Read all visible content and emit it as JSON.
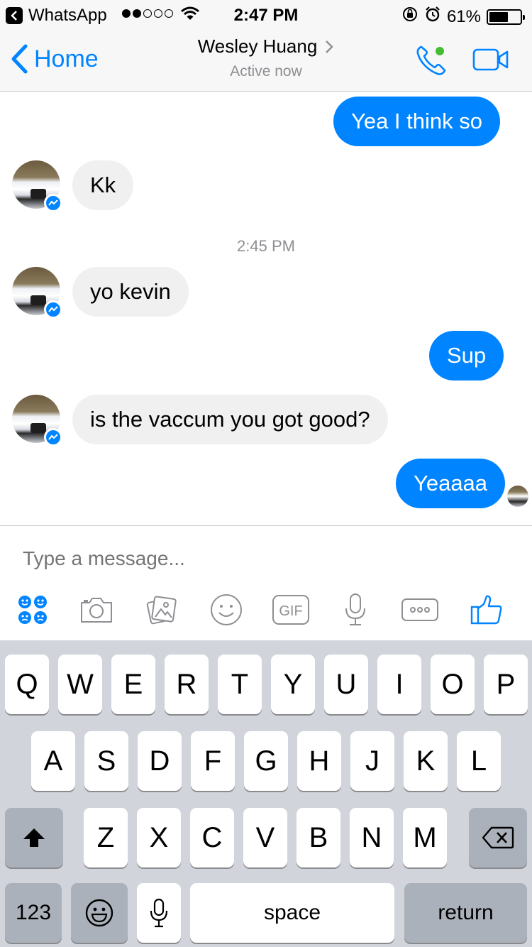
{
  "status_bar": {
    "back_app": "WhatsApp",
    "time": "2:47 PM",
    "battery": "61%",
    "battery_level": 0.61,
    "signal_bars_filled": 2,
    "signal_bars_total": 5
  },
  "nav": {
    "back_label": "Home",
    "contact_name": "Wesley Huang",
    "contact_status": "Active now",
    "accent_color": "#0084ff",
    "online_color": "#44bd32"
  },
  "messages": [
    {
      "direction": "outgoing",
      "text": "Yea I think so"
    },
    {
      "direction": "incoming",
      "text": "Kk"
    },
    {
      "direction": "incoming",
      "text": "yo kevin"
    },
    {
      "direction": "outgoing",
      "text": "Sup"
    },
    {
      "direction": "incoming",
      "text": "is the vaccum you got good?"
    },
    {
      "direction": "outgoing",
      "text": "Yeaaaa"
    }
  ],
  "timestamp": "2:45 PM",
  "composer": {
    "placeholder": "Type a message...",
    "tools": [
      "stickers-icon",
      "camera-icon",
      "gallery-icon",
      "emoji-icon",
      "gif-icon",
      "microphone-icon",
      "more-icon",
      "thumbs-up-icon"
    ],
    "gif_label": "GIF"
  },
  "keyboard": {
    "row1": [
      "Q",
      "W",
      "E",
      "R",
      "T",
      "Y",
      "U",
      "I",
      "O",
      "P"
    ],
    "row2": [
      "A",
      "S",
      "D",
      "F",
      "G",
      "H",
      "J",
      "K",
      "L"
    ],
    "row3": [
      "Z",
      "X",
      "C",
      "V",
      "B",
      "N",
      "M"
    ],
    "numbers_label": "123",
    "space_label": "space",
    "return_label": "return"
  }
}
